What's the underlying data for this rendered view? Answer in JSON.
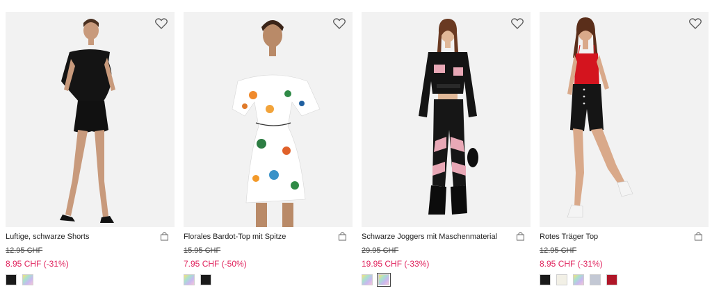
{
  "products": [
    {
      "name": "Luftige, schwarze Shorts",
      "old_price": "12.95 CHF",
      "new_price": "8.95 CHF (-31%)",
      "swatches": [
        {
          "type": "solid",
          "color": "#1a1a1a"
        },
        {
          "type": "multi",
          "color": "multicolor"
        }
      ]
    },
    {
      "name": "Florales Bardot-Top mit Spitze",
      "old_price": "15.95 CHF",
      "new_price": "7.95 CHF (-50%)",
      "swatches": [
        {
          "type": "multi",
          "color": "multicolor"
        },
        {
          "type": "solid",
          "color": "#1a1a1a"
        }
      ]
    },
    {
      "name": "Schwarze Joggers mit Maschenmaterial",
      "old_price": "29.95 CHF",
      "new_price": "19.95 CHF (-33%)",
      "swatches": [
        {
          "type": "multi",
          "color": "multicolor"
        },
        {
          "type": "multi",
          "color": "multicolor",
          "selected": true
        }
      ]
    },
    {
      "name": "Rotes Träger Top",
      "old_price": "12.95 CHF",
      "new_price": "8.95 CHF (-31%)",
      "swatches": [
        {
          "type": "solid",
          "color": "#1a1a1a"
        },
        {
          "type": "solid",
          "color": "#f2f0e6"
        },
        {
          "type": "multi",
          "color": "multicolor"
        },
        {
          "type": "solid",
          "color": "#c3c8d4"
        },
        {
          "type": "solid",
          "color": "#b01628"
        }
      ]
    }
  ],
  "icons": {
    "wishlist": "heart-outline-icon",
    "cart": "shopping-bag-icon"
  },
  "colors": {
    "sale_price": "#e0245e",
    "photo_bg": "#f3f3f3"
  }
}
